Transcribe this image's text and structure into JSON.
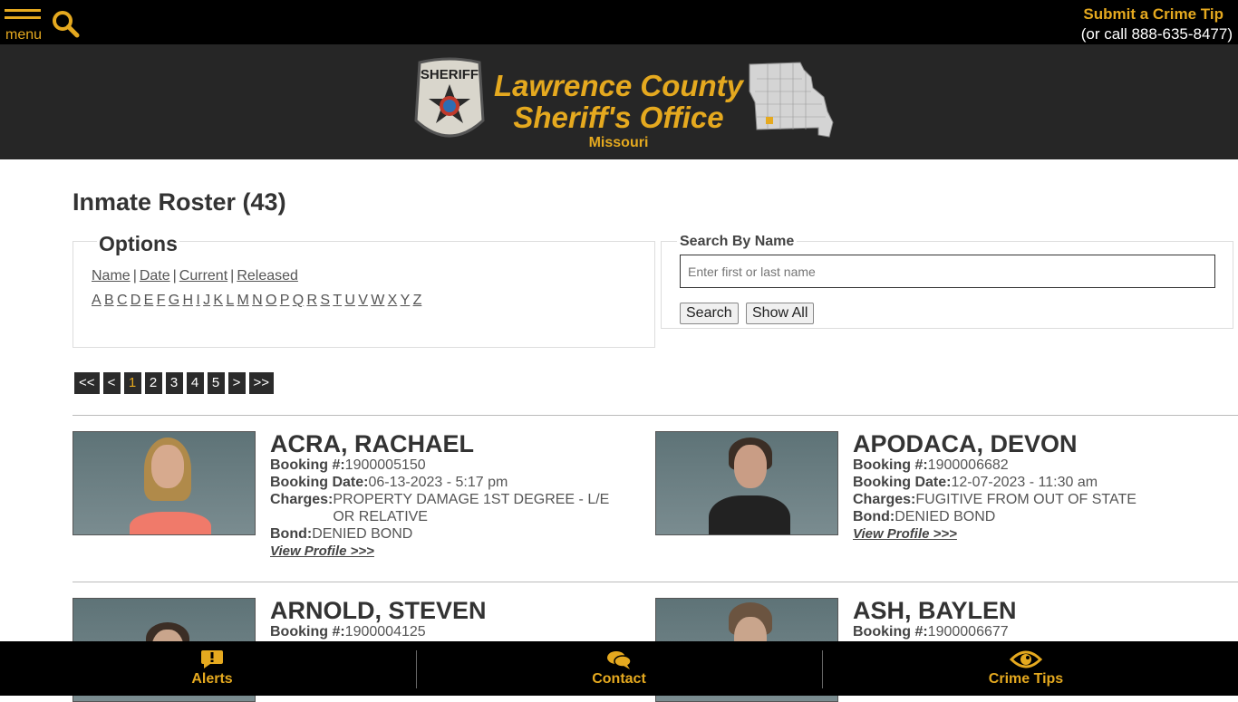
{
  "topbar": {
    "menu_label": "menu",
    "tip_link": "Submit a Crime Tip",
    "tip_phone": "(or call 888-635-8477)"
  },
  "header": {
    "title_line1": "Lawrence County",
    "title_line2": "Sheriff's Office",
    "state": "Missouri",
    "badge_text": "SHERIFF"
  },
  "page": {
    "title": "Inmate Roster (43)"
  },
  "options": {
    "legend": "Options",
    "sort_links": [
      "Name",
      "Date",
      "Current",
      "Released"
    ],
    "letters": [
      "A",
      "B",
      "C",
      "D",
      "E",
      "F",
      "G",
      "H",
      "I",
      "J",
      "K",
      "L",
      "M",
      "N",
      "O",
      "P",
      "Q",
      "R",
      "S",
      "T",
      "U",
      "V",
      "W",
      "X",
      "Y",
      "Z"
    ]
  },
  "search": {
    "legend": "Search By Name",
    "placeholder": "Enter first or last name",
    "search_label": "Search",
    "show_all_label": "Show All"
  },
  "pager": [
    "<<",
    "<",
    "1",
    "2",
    "3",
    "4",
    "5",
    ">",
    ">>"
  ],
  "pager_current": "1",
  "inmates": [
    {
      "name": "ACRA, RACHAEL",
      "booking_no_label": "Booking #:",
      "booking_no": "1900005150",
      "booking_date_label": "Booking Date:",
      "booking_date": "06-13-2023 - 5:17 pm",
      "charges_label": "Charges:",
      "charges": "PROPERTY DAMAGE 1ST DEGREE - L/E OR RELATIVE",
      "bond_label": "Bond:",
      "bond": "DENIED BOND",
      "view": "View Profile >>>"
    },
    {
      "name": "APODACA, DEVON",
      "booking_no_label": "Booking #:",
      "booking_no": "1900006682",
      "booking_date_label": "Booking Date:",
      "booking_date": "12-07-2023 - 11:30 am",
      "charges_label": "Charges:",
      "charges": "FUGITIVE FROM OUT OF STATE",
      "bond_label": "Bond:",
      "bond": "DENIED BOND",
      "view": "View Profile >>>"
    },
    {
      "name": "ARNOLD, STEVEN",
      "booking_no_label": "Booking #:",
      "booking_no": "1900004125"
    },
    {
      "name": "ASH, BAYLEN",
      "booking_no_label": "Booking #:",
      "booking_no": "1900006677"
    }
  ],
  "bottombar": {
    "alerts": "Alerts",
    "contact": "Contact",
    "tips": "Crime Tips"
  },
  "colors": {
    "accent": "#e5a91f",
    "topbar": "#000000",
    "header": "#262626"
  }
}
